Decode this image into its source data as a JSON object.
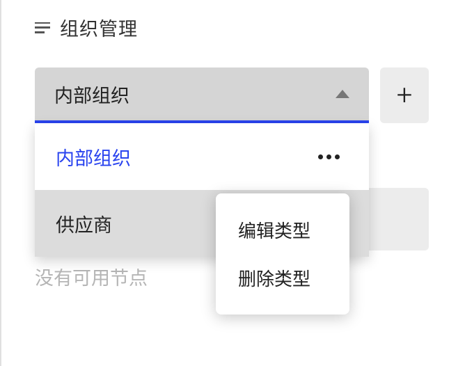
{
  "header": {
    "title": "组织管理"
  },
  "select": {
    "selected_label": "内部组织",
    "options": [
      {
        "label": "内部组织",
        "active": true
      },
      {
        "label": "供应商",
        "active": false
      }
    ]
  },
  "context_menu": {
    "items": [
      {
        "label": "编辑类型"
      },
      {
        "label": "删除类型"
      }
    ]
  },
  "empty_text": "没有可用节点"
}
